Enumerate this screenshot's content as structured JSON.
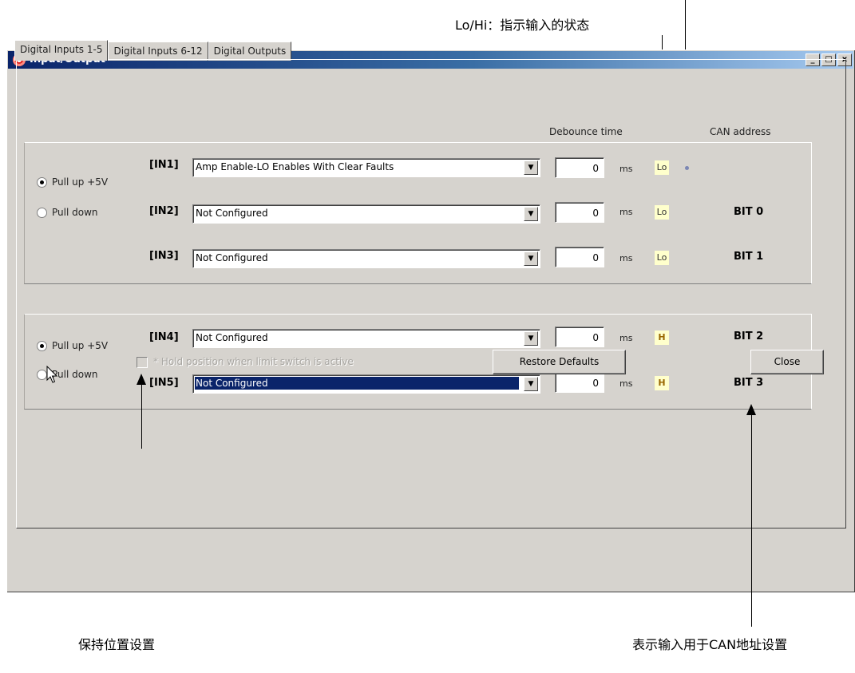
{
  "window": {
    "title": "Input/Output",
    "controls": [
      "_",
      "□",
      "x"
    ]
  },
  "tabs": [
    {
      "label": "Digital Inputs 1-5",
      "active": true
    },
    {
      "label": "Digital Inputs 6-12",
      "active": false
    },
    {
      "label": "Digital Outputs",
      "active": false
    }
  ],
  "headers": {
    "debounce": "Debounce time",
    "can": "CAN address"
  },
  "groups": [
    {
      "pull_up": "Pull up +5V",
      "pull_down": "Pull down",
      "selected": "pull_up",
      "inputs": [
        {
          "label": "[IN1]",
          "function": "Amp Enable-LO Enables With Clear Faults",
          "debounce": "0",
          "unit": "ms",
          "state": "Lo",
          "can": ""
        },
        {
          "label": "[IN2]",
          "function": "Not Configured",
          "debounce": "0",
          "unit": "ms",
          "state": "Lo",
          "can": "BIT 0"
        },
        {
          "label": "[IN3]",
          "function": "Not Configured",
          "debounce": "0",
          "unit": "ms",
          "state": "Lo",
          "can": "BIT 1"
        }
      ]
    },
    {
      "pull_up": "Pull up +5V",
      "pull_down": "Pull down",
      "selected": "pull_up",
      "inputs": [
        {
          "label": "[IN4]",
          "function": "Not Configured",
          "debounce": "0",
          "unit": "ms",
          "state": "H",
          "can": "BIT 2"
        },
        {
          "label": "[IN5]",
          "function": "Not Configured",
          "debounce": "0",
          "unit": "ms",
          "state": "H",
          "can": "BIT 3"
        }
      ]
    }
  ],
  "footer": {
    "hold_checkbox_label": "* Hold position when limit switch is active",
    "hold_checked": false,
    "restore_button": "Restore Defaults",
    "close_button": "Close"
  },
  "annotations": {
    "top": "Lo/Hi：指示输入的状态",
    "bottom_left": "保持位置设置",
    "bottom_right": "表示输入用于CAN地址设置"
  }
}
